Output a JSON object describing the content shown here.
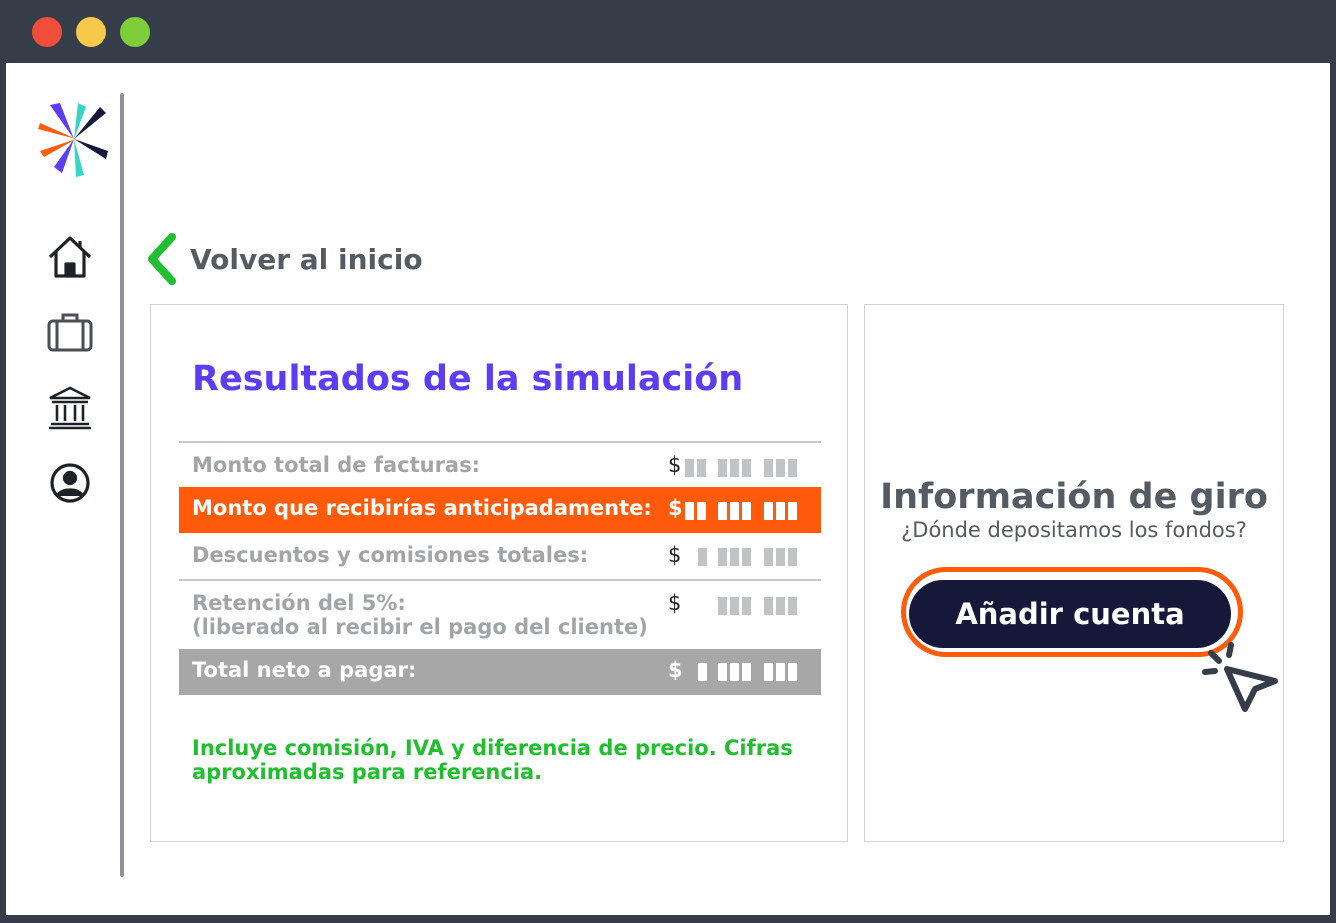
{
  "window": {
    "controls": [
      "close",
      "minimize",
      "maximize"
    ]
  },
  "sidebar": {
    "logo_icon": "asterisk-logo",
    "nav_items": [
      {
        "icon": "home-icon"
      },
      {
        "icon": "briefcase-icon"
      },
      {
        "icon": "bank-icon"
      },
      {
        "icon": "user-icon"
      }
    ]
  },
  "back_link": {
    "label": "Volver al inicio"
  },
  "simulation": {
    "title": "Resultados de la simulación",
    "currency": "$",
    "rows": [
      {
        "label": "Monto total de facturas:",
        "highlight": "none"
      },
      {
        "label": "Monto que recibirías anticipadamente:",
        "highlight": "orange"
      },
      {
        "label": "Descuentos y comisiones totales:",
        "highlight": "none"
      },
      {
        "label": "Retención del 5%:",
        "sublabel": "(liberado al recibir el pago del cliente)",
        "highlight": "none"
      },
      {
        "label": "Total neto a pagar:",
        "highlight": "gray"
      }
    ],
    "note": "Incluye comisión, IVA y diferencia de precio. Cifras aproximadas para referencia."
  },
  "giro": {
    "title": "Información de giro",
    "subtitle": "¿Dónde depositamos los fondos?",
    "button_label": "Añadir cuenta"
  },
  "colors": {
    "accent_purple": "#5c3df2",
    "accent_orange": "#ff5b0a",
    "accent_green": "#1fbf2e",
    "button_navy": "#16183a",
    "frame": "#343d48"
  }
}
